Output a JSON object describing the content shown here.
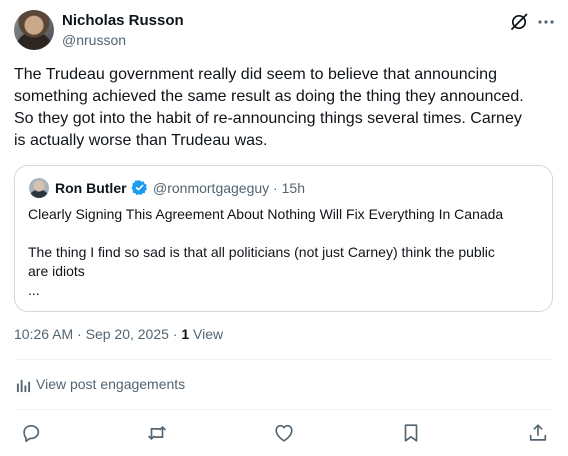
{
  "post": {
    "author_name": "Nicholas Russon",
    "author_handle": "@nrusson",
    "text_lines": [
      "The Trudeau government really did seem to believe that announcing",
      "something achieved the same result as doing the thing they announced.",
      "So they got into the habit of re-announcing things several times. Carney",
      "is actually worse than Trudeau was."
    ],
    "time": "10:26 AM",
    "date": "Sep 20, 2025",
    "views_count": "1",
    "views_label": "View"
  },
  "quote": {
    "author_name": "Ron Butler",
    "author_handle": "@ronmortgageguy",
    "age": "15h",
    "lines": [
      "Clearly Signing This Agreement About Nothing Will Fix Everything In Canada",
      "The thing I find so sad is that all politicians (not just Carney) think the public",
      "are idiots",
      "..."
    ]
  },
  "engagements_label": "View post engagements",
  "icons": {
    "grok": "grok-icon",
    "more": "more-icon",
    "verified": "verified-badge-icon",
    "analytics": "analytics-icon",
    "reply": "reply-icon",
    "repost": "repost-icon",
    "like": "like-icon",
    "bookmark": "bookmark-icon",
    "share": "share-icon"
  },
  "colors": {
    "text": "#0f1419",
    "secondary": "#536471",
    "border": "#cfd9de",
    "verified": "#1d9bf0"
  }
}
